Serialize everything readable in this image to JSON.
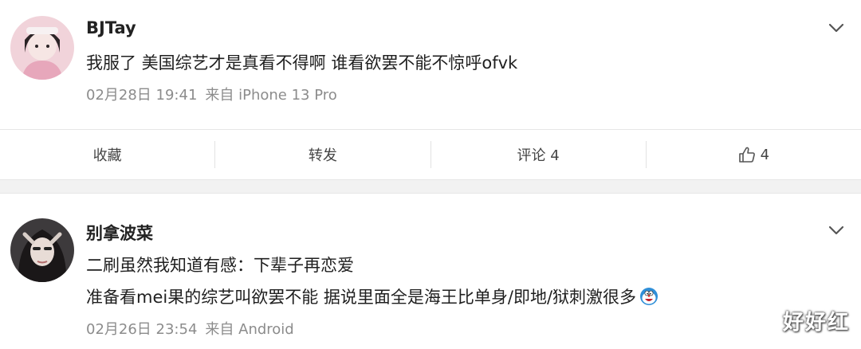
{
  "posts": [
    {
      "username": "BJTay",
      "lines": [
        "我服了 美国综艺才是真看不得啊 谁看欲罢不能不惊呼ofvk"
      ],
      "date": "02月28日 19:41",
      "source": "来自 iPhone 13 Pro"
    },
    {
      "username": "别拿波菜",
      "lines": [
        "二刷虽然我知道有感：下辈子再恋爱",
        "准备看mei果的综艺叫欲罢不能 据说里面全是海王比单身/即地/狱刺激很多"
      ],
      "date": "02月26日 23:54",
      "source": "来自 Android"
    }
  ],
  "actions": {
    "favorite": "收藏",
    "repost": "转发",
    "comment": "评论 4",
    "like_count": "4"
  },
  "watermark": "好好红",
  "icons": {
    "expand": "chevron-down-icon",
    "like": "thumbs-up-icon",
    "emoji": "doraemon-emoji-icon"
  },
  "colors": {
    "text": "#1f1f1f",
    "meta": "#8c8c8c",
    "separator_band": "#f2f2f2"
  }
}
